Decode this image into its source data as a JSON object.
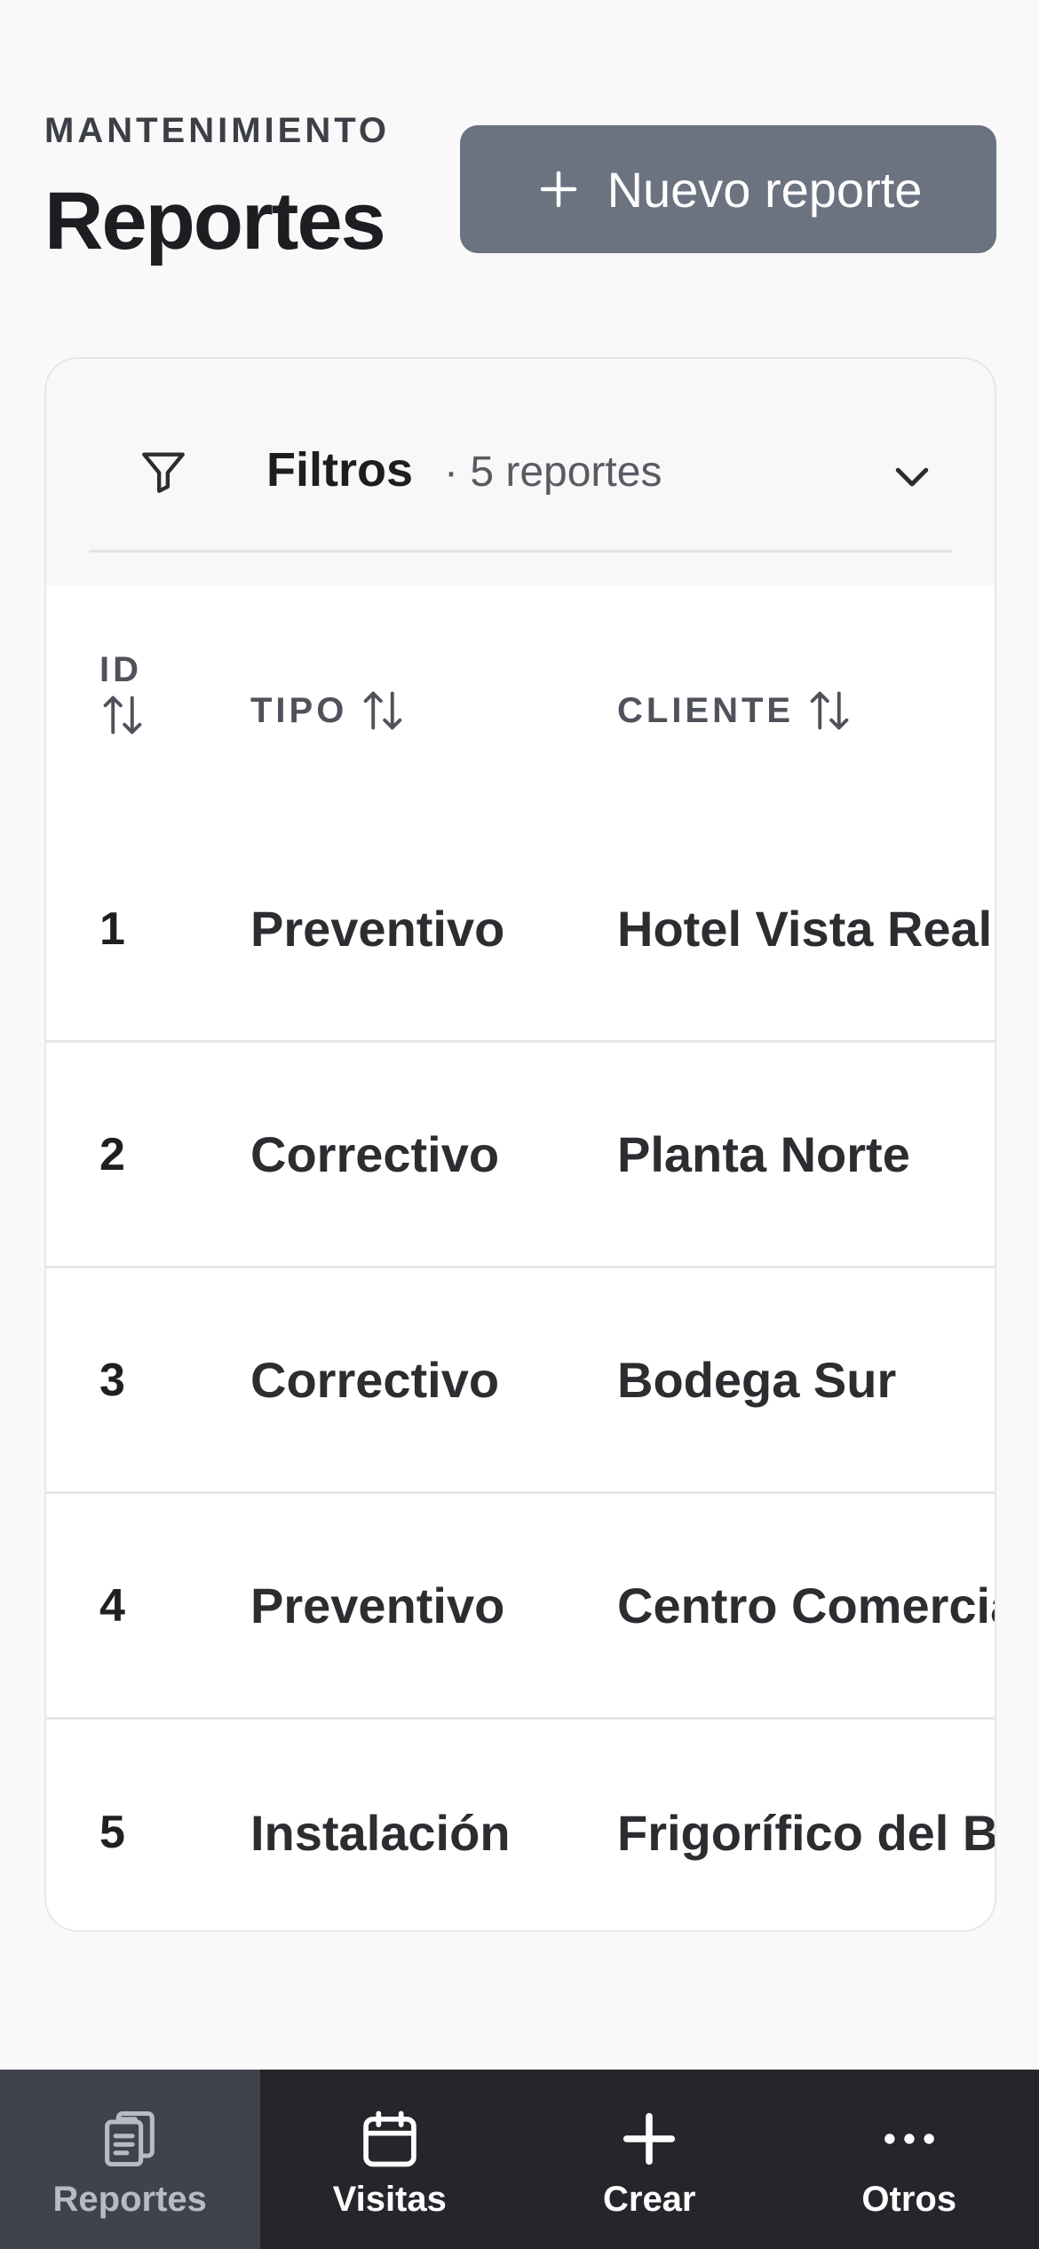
{
  "header": {
    "eyebrow": "MANTENIMIENTO",
    "title": "Reportes",
    "new_report_label": "Nuevo reporte"
  },
  "filters": {
    "label": "Filtros",
    "count_text": "· 5 reportes"
  },
  "table": {
    "columns": {
      "id": "ID",
      "tipo": "TIPO",
      "cliente": "CLIENTE"
    },
    "rows": [
      {
        "id": "1",
        "tipo": "Preventivo",
        "cliente": "Hotel Vista Real"
      },
      {
        "id": "2",
        "tipo": "Correctivo",
        "cliente": "Planta Norte"
      },
      {
        "id": "3",
        "tipo": "Correctivo",
        "cliente": "Bodega Sur"
      },
      {
        "id": "4",
        "tipo": "Preventivo",
        "cliente": "Centro Comercia"
      },
      {
        "id": "5",
        "tipo": "Instalación",
        "cliente": "Frigorífico del B"
      }
    ]
  },
  "nav": {
    "items": [
      {
        "label": "Reportes",
        "icon": "clipboard-icon",
        "active": true
      },
      {
        "label": "Visitas",
        "icon": "calendar-icon",
        "active": false
      },
      {
        "label": "Crear",
        "icon": "plus-icon",
        "active": false
      },
      {
        "label": "Otros",
        "icon": "more-dots-icon",
        "active": false
      }
    ]
  },
  "colors": {
    "primary_button": "#6b7280",
    "nav_background": "#24262b",
    "nav_active": "#40434c"
  }
}
